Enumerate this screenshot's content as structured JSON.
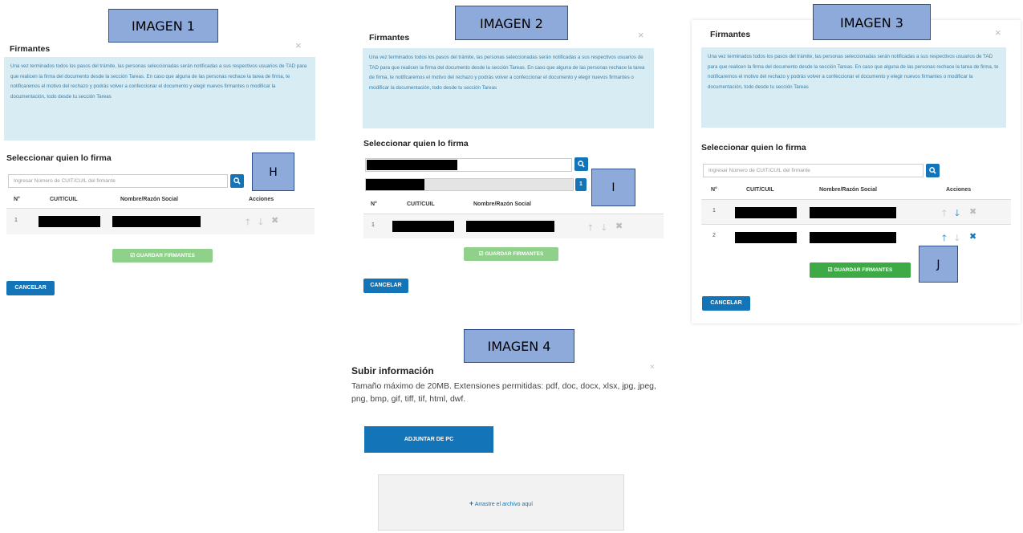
{
  "labels": {
    "img1": "IMAGEN  1",
    "img2": "IMAGEN  2",
    "img3": "IMAGEN  3",
    "img4": "IMAGEN  4",
    "h": "H",
    "i": "I",
    "j": "J"
  },
  "firmantes": {
    "title": "Firmantes",
    "close": "×",
    "info": "Una vez terminados todos los pasos del trámite, las personas seleccionadas serán notificadas a sus respectivos usuarios de TAD para que realicen la firma del documento desde la sección Tareas. En caso que alguna de las personas rechace la tarea de firma, te notificaremos el motivo del rechazo y podrás volver a confeccionar el documento y elegir nuevos firmantes o modificar la documentación, todo desde tu sección Tareas",
    "select_label": "Seleccionar quien lo firma",
    "search_placeholder": "Ingresar Número de CUIT/CUIL del firmante",
    "col_num": "N°",
    "col_cuit": "CUIT/CUIL",
    "col_name": "Nombre/Razón Social",
    "col_actions": "Acciones",
    "row1_num": "1",
    "row2_num": "2",
    "save_label": "GUARDAR FIRMANTES",
    "cancel_label": "CANCELAR",
    "dropdown_count": "1"
  },
  "upload": {
    "title": "Subir información",
    "close": "×",
    "desc": "Tamaño máximo de 20MB. Extensiones permitidas: pdf, doc, docx, xlsx, jpg, jpeg, png, bmp, gif, tiff, tif, html, dwf.",
    "attach_label": "ADJUNTAR DE PC",
    "drop_label": "Arrastre el archivo aquí",
    "drop_icon": "+"
  },
  "colors": {
    "primary": "#1474b8",
    "save_disabled": "#8fd08b",
    "save_enabled": "#3daa45",
    "info_bg": "#d8ecf4",
    "tag_bg": "#8eaadb"
  }
}
